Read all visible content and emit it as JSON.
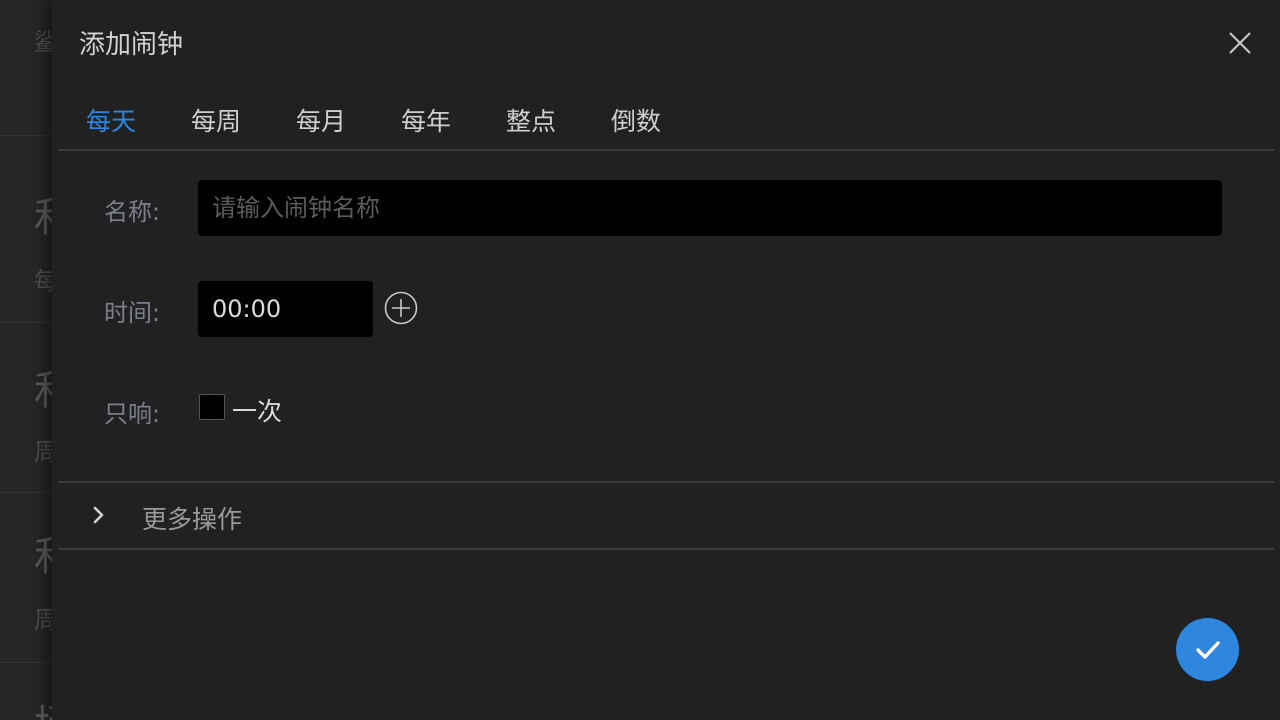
{
  "background_list": {
    "top_fragment": "鲨",
    "items": [
      {
        "big": "和",
        "small": "每"
      },
      {
        "big": "和",
        "small": "周"
      },
      {
        "big": "和",
        "small": "周"
      },
      {
        "big": "场",
        "small": ""
      }
    ]
  },
  "dialog": {
    "title": "添加闹钟",
    "close_icon": "close-icon"
  },
  "tabs": [
    {
      "label": "每天",
      "active": true
    },
    {
      "label": "每周",
      "active": false
    },
    {
      "label": "每月",
      "active": false
    },
    {
      "label": "每年",
      "active": false
    },
    {
      "label": "整点",
      "active": false
    },
    {
      "label": "倒数",
      "active": false
    }
  ],
  "form": {
    "name_label": "名称:",
    "name_placeholder": "请输入闹钟名称",
    "name_value": "",
    "time_label": "时间:",
    "time_value": "00:00",
    "add_time_icon": "plus-circle-icon",
    "once_label": "只响:",
    "once_option": "一次",
    "once_checked": false
  },
  "more": {
    "label": "更多操作",
    "icon": "chevron-right-icon"
  },
  "confirm": {
    "icon": "check-icon"
  },
  "colors": {
    "accent": "#2e86de",
    "dialog_bg": "#212121",
    "input_bg": "#000000",
    "label": "#7a7f8a"
  }
}
